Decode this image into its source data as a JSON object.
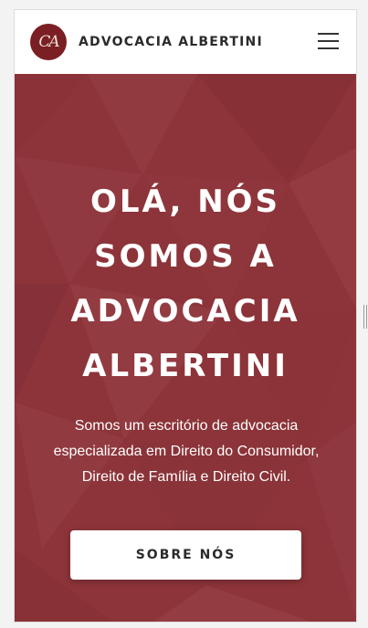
{
  "header": {
    "logo_text": "CA",
    "brand_name": "ADVOCACIA ALBERTINI"
  },
  "hero": {
    "title_lines": [
      "OLÁ, NÓS",
      "SOMOS A",
      "ADVOCACIA",
      "ALBERTINI"
    ],
    "description_lines": [
      "Somos um escritório de advocacia",
      "especializada em Direito do Consumidor,",
      "Direito de Família e Direito Civil."
    ],
    "cta_label": "SOBRE NÓS"
  },
  "colors": {
    "hero_background": "#8c3439",
    "logo_background": "#7a1f23",
    "header_background": "#ffffff"
  },
  "icons": {
    "menu": "hamburger-menu-icon",
    "resize_handle": "drag-handle-icon"
  }
}
